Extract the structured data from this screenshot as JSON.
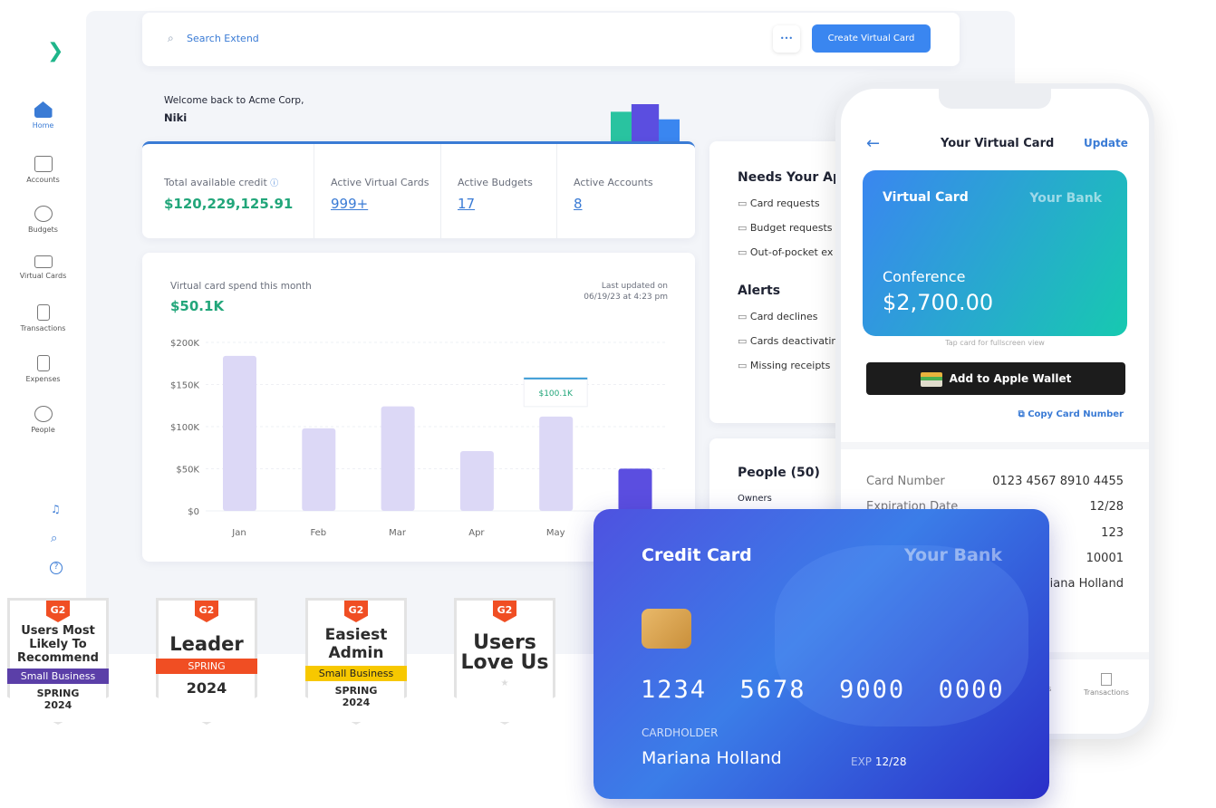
{
  "sidebar": {
    "items": [
      {
        "label": "Home",
        "icon": "home-icon"
      },
      {
        "label": "Accounts",
        "icon": "accounts-icon"
      },
      {
        "label": "Budgets",
        "icon": "budgets-icon"
      },
      {
        "label": "Virtual Cards",
        "icon": "card-icon"
      },
      {
        "label": "Transactions",
        "icon": "receipt-icon"
      },
      {
        "label": "Expenses",
        "icon": "expense-icon"
      },
      {
        "label": "People",
        "icon": "people-icon"
      }
    ]
  },
  "header": {
    "search_placeholder": "Search Extend",
    "more": "•••",
    "create_button": "Create Virtual Card"
  },
  "welcome": {
    "line": "Welcome back to Acme Corp,",
    "name": "Niki"
  },
  "stats": [
    {
      "label": "Total available credit",
      "value": "$120,229,125.91"
    },
    {
      "label": "Active Virtual Cards",
      "value": "999+"
    },
    {
      "label": "Active Budgets",
      "value": "17"
    },
    {
      "label": "Active Accounts",
      "value": "8"
    }
  ],
  "chart_data": {
    "type": "bar",
    "title": "Virtual card spend this month",
    "headline": "$50.1K",
    "updated_label": "Last updated on",
    "updated_time": "06/19/23 at 4:23 pm",
    "categories": [
      "Jan",
      "Feb",
      "Mar",
      "Apr",
      "May",
      ""
    ],
    "values": [
      184,
      98,
      124,
      71,
      112,
      50.1
    ],
    "yticks": [
      "$0",
      "$50K",
      "$100K",
      "$150K",
      "$200K"
    ],
    "ylim": [
      0,
      200
    ],
    "tooltip": "$100.1K",
    "highlight_color": "#5b4ee0",
    "bar_color": "#dcd8f6"
  },
  "approval": {
    "title": "Needs Your Ap",
    "items": [
      "Card requests",
      "Budget requests",
      "Out-of-pocket ex"
    ],
    "alerts_title": "Alerts",
    "alerts": [
      "Card declines",
      "Cards deactivatin",
      "Missing receipts"
    ]
  },
  "people": {
    "title": "People (50)",
    "sub": "Owners"
  },
  "phone": {
    "title": "Your Virtual Card",
    "update": "Update",
    "card_title": "Virtual Card",
    "bank": "Your Bank",
    "card_name": "Conference",
    "amount": "$2,700.00",
    "hint": "Tap card for fullscreen view",
    "wallet_button": "Add to Apple Wallet",
    "copy": "Copy Card Number",
    "details": [
      {
        "label": "Card Number",
        "value": "0123 4567 8910 4455"
      },
      {
        "label": "Expiration Date",
        "value": "12/28"
      },
      {
        "label": "",
        "value": "123"
      },
      {
        "label": "",
        "value": "10001"
      },
      {
        "label": "",
        "value": "iana Holland"
      }
    ],
    "tabs": [
      "rds",
      "Transactions"
    ]
  },
  "credit_card": {
    "title": "Credit Card",
    "bank": "Your Bank",
    "number": "1234  5678  9000  0000",
    "holder_label": "CARDHOLDER",
    "holder": "Mariana Holland",
    "exp_label": "EXP",
    "exp": "12/28"
  },
  "badges": [
    {
      "lines": [
        "Users Most",
        "Likely To",
        "Recommend"
      ],
      "ribbon": "Small Business",
      "ribbon_color": "#5b3fa8",
      "foot": "SPRING 2024"
    },
    {
      "lines": [
        "Leader"
      ],
      "ribbon": "SPRING",
      "ribbon_color": "#f04e23",
      "foot": "2024"
    },
    {
      "lines": [
        "Easiest",
        "Admin"
      ],
      "ribbon": "Small Business",
      "ribbon_color": "#f7c800",
      "foot": "SPRING 2024"
    },
    {
      "lines": [
        "Users",
        "Love Us"
      ],
      "ribbon": "",
      "ribbon_color": "",
      "foot": ""
    }
  ],
  "g2": "G2"
}
